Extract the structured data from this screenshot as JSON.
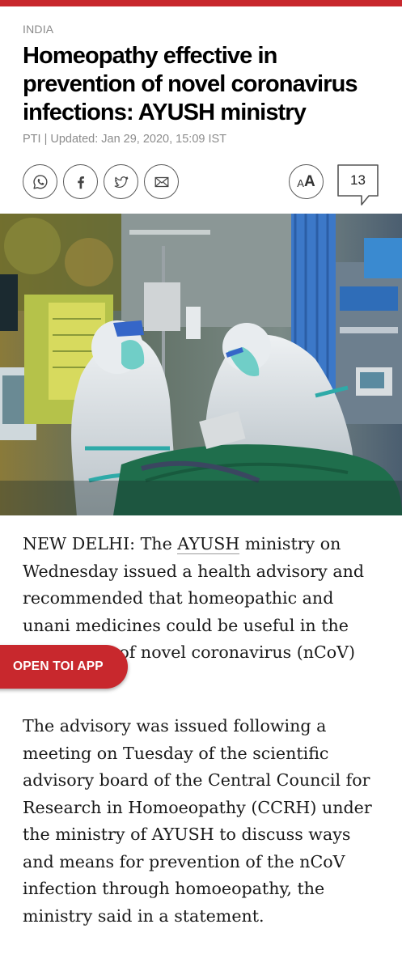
{
  "header": {
    "section": "INDIA",
    "headline": "Homeopathy effective in prevention of novel coronavirus infections: AYUSH ministry",
    "byline": "PTI | Updated: Jan 29, 2020, 15:09 IST"
  },
  "toolbar": {
    "share_icons": [
      "whatsapp-icon",
      "facebook-icon",
      "twitter-icon",
      "email-icon"
    ],
    "font_size_small": "A",
    "font_size_large": "A",
    "comment_count": "13"
  },
  "article": {
    "p1_before_link": "NEW DELHI: The ",
    "p1_link": "AYUSH",
    "p1_after_link": " ministry on Wednesday issued a health advisory and recommended that homeopathic and unani medicines could be useful in the prevention of novel coronavirus (nCoV) infections.",
    "p2": "The advisory was issued following a meeting on Tuesday of the scientific advisory board of the Central Council for Research in Homoeopathy (CCRH) under the ministry of AYUSH to discuss ways and means for prevention of the nCoV infection through homoeopathy, the ministry said in a statement."
  },
  "cta": {
    "open_app_label": "OPEN TOI APP"
  },
  "colors": {
    "brand_red": "#c8282d",
    "muted_text": "#8a8a8a"
  }
}
